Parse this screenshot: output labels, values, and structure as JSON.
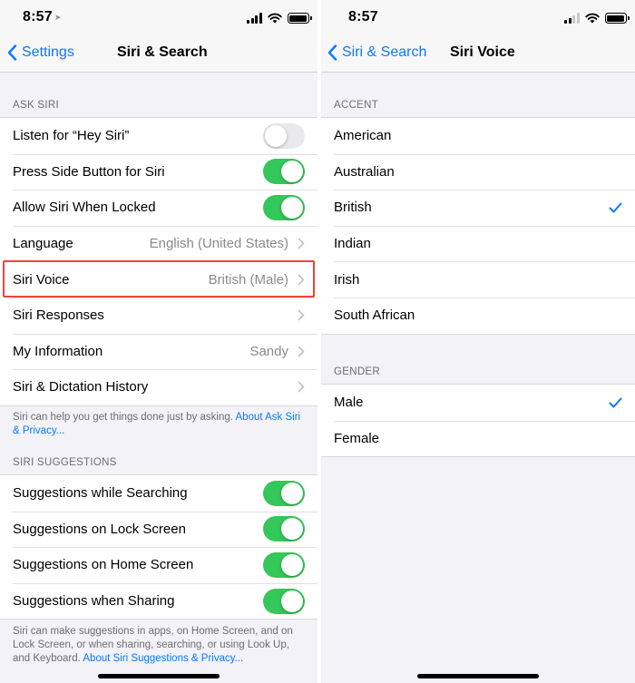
{
  "left": {
    "status": {
      "time": "8:57"
    },
    "nav": {
      "back_label": "Settings",
      "title": "Siri & Search"
    },
    "ask_siri": {
      "header": "ASK SIRI",
      "hey_siri": {
        "label": "Listen for “Hey Siri”",
        "on": false
      },
      "side_button": {
        "label": "Press Side Button for Siri",
        "on": true
      },
      "allow_locked": {
        "label": "Allow Siri When Locked",
        "on": true
      },
      "language": {
        "label": "Language",
        "value": "English (United States)"
      },
      "siri_voice": {
        "label": "Siri Voice",
        "value": "British (Male)"
      },
      "siri_responses": {
        "label": "Siri Responses"
      },
      "my_information": {
        "label": "My Information",
        "value": "Sandy"
      },
      "dictation_history": {
        "label": "Siri & Dictation History"
      },
      "footer_text": "Siri can help you get things done just by asking. ",
      "footer_link": "About Ask Siri & Privacy..."
    },
    "suggestions": {
      "header": "SIRI SUGGESTIONS",
      "items": [
        {
          "label": "Suggestions while Searching",
          "on": true
        },
        {
          "label": "Suggestions on Lock Screen",
          "on": true
        },
        {
          "label": "Suggestions on Home Screen",
          "on": true
        },
        {
          "label": "Suggestions when Sharing",
          "on": true
        }
      ],
      "footer_text": "Siri can make suggestions in apps, on Home Screen, and on Lock Screen, or when sharing, searching, or using Look Up, and Keyboard. ",
      "footer_link": "About Siri Suggestions & Privacy..."
    }
  },
  "right": {
    "status": {
      "time": "8:57"
    },
    "nav": {
      "back_label": "Siri & Search",
      "title": "Siri Voice"
    },
    "accent": {
      "header": "ACCENT",
      "options": [
        "American",
        "Australian",
        "British",
        "Indian",
        "Irish",
        "South African"
      ],
      "selected": "British"
    },
    "gender": {
      "header": "GENDER",
      "options": [
        "Male",
        "Female"
      ],
      "selected": "Male"
    }
  },
  "colors": {
    "accent": "#0a7aff",
    "toggle_on": "#34c759",
    "highlight": "#e8463a"
  },
  "icons": [
    "location-arrow-icon",
    "cellular-signal-icon",
    "wifi-icon",
    "battery-icon",
    "back-chevron-icon",
    "chevron-right-icon",
    "checkmark-icon"
  ]
}
